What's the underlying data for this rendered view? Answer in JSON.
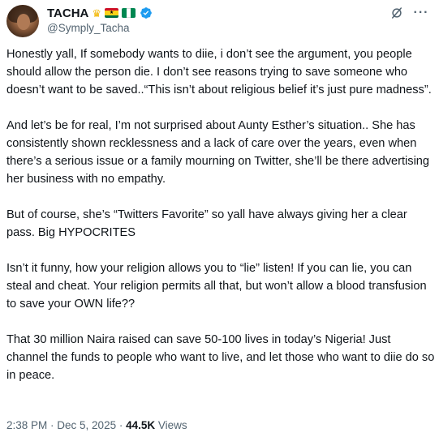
{
  "author": {
    "display_name": "TACHA",
    "handle": "@Symply_Tacha",
    "decorations": [
      "crown-emoji",
      "ghana-flag-emoji",
      "nigeria-flag-emoji"
    ],
    "verified": true
  },
  "header_actions": {
    "grok_icon": "grok-icon",
    "more_icon": "more-icon",
    "more_label": "···"
  },
  "tweet": {
    "paragraphs": [
      "Honestly yall, If somebody wants to diie, i don’t see the argument, you people should allow the person die. I don’t see reasons trying to save someone who doesn’t want to be saved..“This isn’t about religious belief it’s just pure madness”.",
      "And let’s be for real, I’m not surprised about Aunty Esther’s situation.. She has consistently shown recklessness and a lack of care over the years, even when there’s a serious issue or a family mourning on Twitter, she’ll be there advertising her business with no empathy.",
      "But of course, she’s “Twitters Favorite” so yall have always giving her a clear pass. Big HYPOCRITES",
      "Isn’t it funny, how your religion allows you to “lie” listen! If you can lie, you can steal and cheat. Your religion permits all that, but won’t allow a blood transfusion to save your OWN life??",
      "That 30 million Naira raised can save 50-100 lives in today’s Nigeria! Just channel the funds to people who want to live, and let those who want to diie do so in peace."
    ]
  },
  "meta": {
    "time": "2:38 PM",
    "separator": " · ",
    "date": "Dec 5, 2025",
    "views_count": "44.5K",
    "views_label": " Views"
  },
  "colors": {
    "text": "#0f1419",
    "secondary": "#536471",
    "verified": "#1d9bf0",
    "background": "#ffffff"
  }
}
